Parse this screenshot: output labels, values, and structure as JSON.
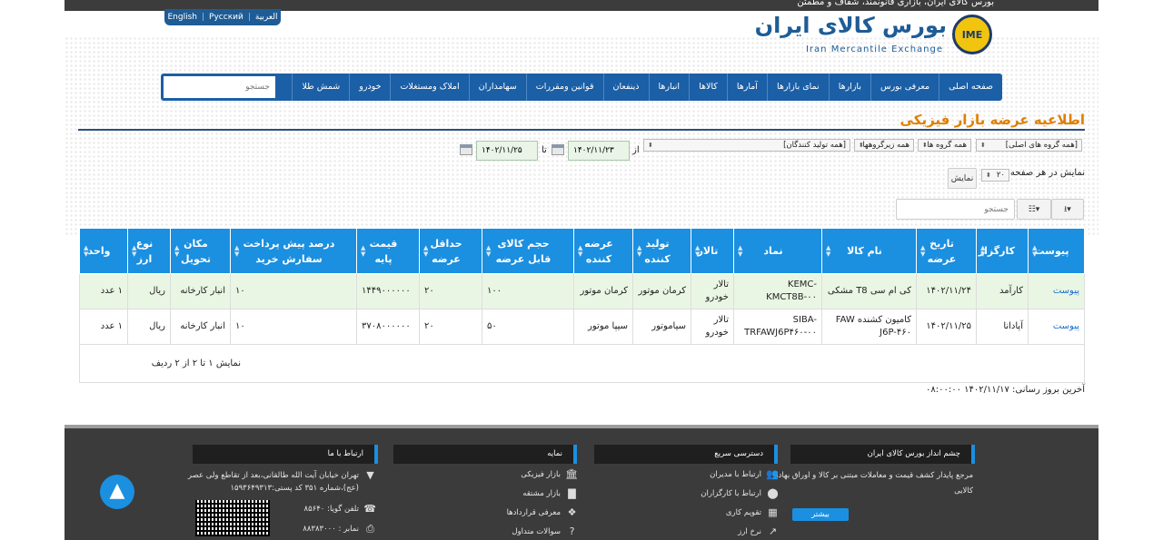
{
  "header": {
    "tagline": "بورس کالای ایران، بازاری قانونمند، شفاف و مطمئن",
    "languages": [
      "English",
      "Русский",
      "العربية"
    ],
    "logo_fa": "بورس کالای ایران",
    "logo_en": "Iran Mercantile Exchange",
    "logo_mark": "IME"
  },
  "nav": {
    "items": [
      "صفحه اصلی",
      "معرفی بورس",
      "بازارها",
      "نمای بازارها",
      "آمارها",
      "کالاها",
      "انبارها",
      "ذینفعان",
      "قوانین ومقررات",
      "سهامداران",
      "املاک ومستغلات",
      "خودرو",
      "شمش طلا"
    ],
    "search_placeholder": "جستجو"
  },
  "page": {
    "title": "اطلاعیه عرضه بازار فیزیکی"
  },
  "filters": {
    "main_group": "[همه گروه های اصلی]",
    "group": "همه گروه ها",
    "subgroup": "همه زیرگروهها",
    "producer": "[همه تولید کنندگان]",
    "from_label": "از",
    "from_date": "۱۴۰۲/۱۱/۲۳",
    "to_label": "تا",
    "to_date": "۱۴۰۲/۱۱/۲۵",
    "page_size_label": "نمایش در هر صفحه",
    "page_size": "۲۰",
    "show_button": "نمایش",
    "search_placeholder": "جستجو"
  },
  "table": {
    "columns": [
      "پیوست",
      "کارگزار",
      "تاریخ عرضه",
      "نام کالا",
      "نماد",
      "تالار",
      "تولید کننده",
      "عرضه کننده",
      "حجم کالای قابل عرضه",
      "حداقل عرضه",
      "قیمت پایه",
      "درصد پیش پرداخت سفارش خرید",
      "مکان تحویل",
      "نوع ارز",
      "واحد"
    ],
    "rows": [
      [
        "پیوست",
        "کارآمد",
        "۱۴۰۲/۱۱/۲۴",
        "کی ام سی T8 مشکی",
        "KEMC-KMCT8B-۰۰",
        "تالار خودرو",
        "کرمان موتور",
        "کرمان موتور",
        "۱۰۰",
        "۲۰",
        "۱۴۴۹۰۰۰۰۰۰",
        "۱۰",
        "انبار کارخانه",
        "ریال",
        "۱ عدد"
      ],
      [
        "پیوست",
        "آپادانا",
        "۱۴۰۲/۱۱/۲۵",
        "کامیون کشنده FAW J6P-۴۶۰",
        "SIBA-TRFAWJ6P۴۶۰-۰۰",
        "تالار خودرو",
        "سیاموتور",
        "سیپا موتور",
        "۵۰",
        "۲۰",
        "۳۷۰۸۰۰۰۰۰۰",
        "۱۰",
        "انبار کارخانه",
        "ریال",
        "۱ عدد"
      ]
    ],
    "summary": "نمایش ۱ تا ۲ از ۲ ردیف"
  },
  "last_update": "آخرین بروز رسانی: ۱۴۰۲/۱۱/۱۷ ۰۸:۰۰:۰۰",
  "footer": {
    "vision_title": "چشم انداز بورس کالای ایران",
    "vision_text1": "مرجع پایدار کشف قیمت و معاملات مبتنی بر کالا و اوراق بهادار",
    "vision_text2": "کالایی",
    "more_button": "بیشتر",
    "quick_title": "دسترسی سریع",
    "quick_items": [
      "ارتباط با مدیران",
      "ارتباط با کارگزاران",
      "تقویم کاری",
      "نرخ ارز"
    ],
    "index_title": "نمایه",
    "index_items": [
      "بازار فیزیکی",
      "بازار مشتقه",
      "معرفی قراردادها",
      "سوالات متداول"
    ],
    "contact_title": "ارتباط با ما",
    "address1": "تهران خیابان آیت الله طالقانی،بعد از تقاطع ولی عصر",
    "address2": "(عج)،شماره ۳۵۱ کد پستی:۱۵۹۳۶۴۹۳۱۳",
    "phone": "تلفن گویا: ۸۵۶۴۰",
    "fax": "نمابر : ۸۸۳۸۳۰۰۰"
  }
}
